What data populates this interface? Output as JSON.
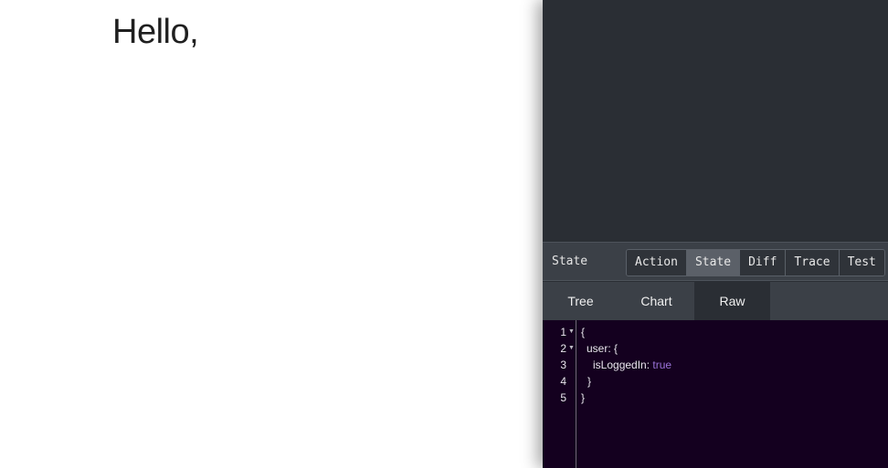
{
  "page": {
    "greeting": "Hello,"
  },
  "devtools": {
    "monitor_title": "State",
    "monitor_buttons": [
      {
        "label": "Action",
        "active": false
      },
      {
        "label": "State",
        "active": true
      },
      {
        "label": "Diff",
        "active": false
      },
      {
        "label": "Trace",
        "active": false
      },
      {
        "label": "Test",
        "active": false
      }
    ],
    "subtabs": [
      {
        "label": "Tree",
        "active": false
      },
      {
        "label": "Chart",
        "active": false
      },
      {
        "label": "Raw",
        "active": true
      }
    ],
    "editor": {
      "lines": [
        {
          "number": "1",
          "folded_marker": true,
          "key": "{",
          "value": ""
        },
        {
          "number": "2",
          "folded_marker": true,
          "key": "user: {",
          "value": ""
        },
        {
          "number": "3",
          "folded_marker": false,
          "key": "isLoggedIn: ",
          "value": "true"
        },
        {
          "number": "4",
          "folded_marker": false,
          "key": "}",
          "value": ""
        },
        {
          "number": "5",
          "folded_marker": false,
          "key": "}",
          "value": ""
        }
      ]
    },
    "colors": {
      "panel_bg": "#2a2e34",
      "toolbar_bg": "#3b4047",
      "editor_bg": "#14001f",
      "boolean": "#9a74d8"
    }
  }
}
